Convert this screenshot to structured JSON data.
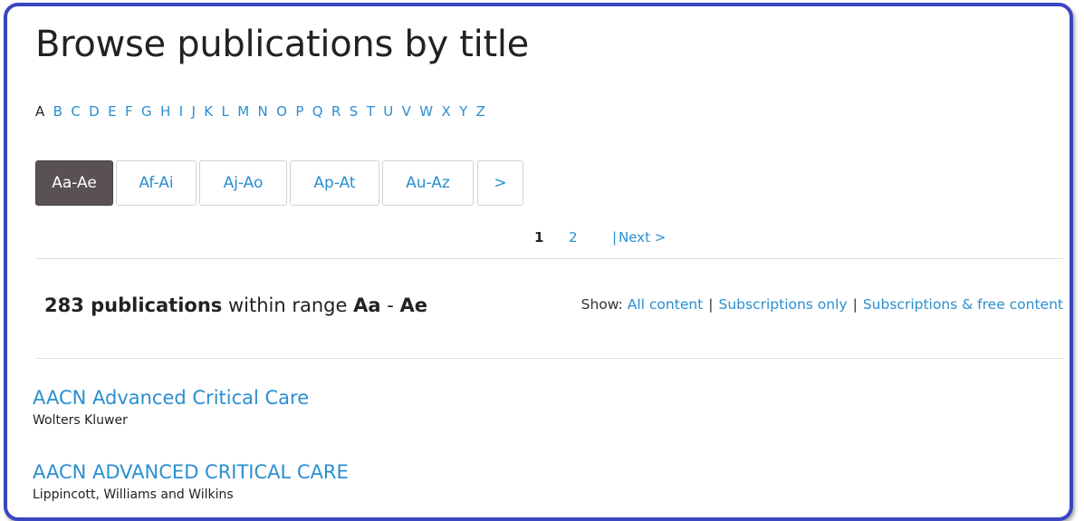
{
  "page": {
    "title": "Browse publications by title"
  },
  "alphabet": {
    "current": "A",
    "letters": [
      "A",
      "B",
      "C",
      "D",
      "E",
      "F",
      "G",
      "H",
      "I",
      "J",
      "K",
      "L",
      "M",
      "N",
      "O",
      "P",
      "Q",
      "R",
      "S",
      "T",
      "U",
      "V",
      "W",
      "X",
      "Y",
      "Z"
    ]
  },
  "range_tabs": [
    {
      "label": "Aa-Ae",
      "active": true
    },
    {
      "label": "Af-Ai",
      "active": false
    },
    {
      "label": "Aj-Ao",
      "active": false
    },
    {
      "label": "Ap-At",
      "active": false
    },
    {
      "label": "Au-Az",
      "active": false
    },
    {
      "label": ">",
      "active": false
    }
  ],
  "pagination": {
    "current": "1",
    "pages": [
      "2"
    ],
    "separator": "|",
    "next_label": "Next >"
  },
  "results": {
    "count": "283 publications",
    "within_text": "within range",
    "range_start": "Aa",
    "range_dash": "-",
    "range_end": "Ae"
  },
  "show_filter": {
    "label": "Show:",
    "options": [
      "All content",
      "Subscriptions only",
      "Subscriptions & free content"
    ],
    "separator": "|"
  },
  "publications": [
    {
      "title": "AACN Advanced Critical Care",
      "publisher": "Wolters Kluwer"
    },
    {
      "title": "AACN ADVANCED CRITICAL CARE",
      "publisher": "Lippincott, Williams and Wilkins"
    }
  ],
  "colors": {
    "link": "#2a8fd0",
    "active_tab_bg": "#5a5152",
    "frame_border": "#3b45c2",
    "text": "#222222"
  }
}
